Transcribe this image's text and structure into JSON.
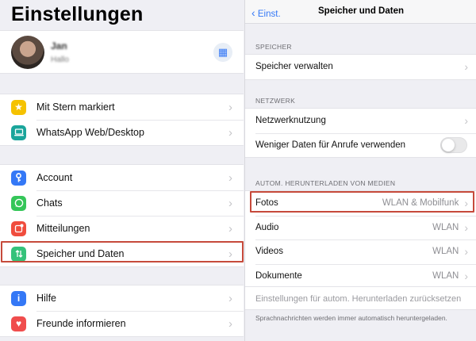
{
  "left": {
    "title": "Einstellungen",
    "profile": {
      "name": "Jan",
      "status": "Hallo",
      "qr_icon": "qr-code-icon"
    },
    "group1": [
      {
        "label": "Mit Stern markiert",
        "icon": "star-icon",
        "color": "#f5c200"
      },
      {
        "label": "WhatsApp Web/Desktop",
        "icon": "laptop-icon",
        "color": "#1aa59b"
      }
    ],
    "group2": [
      {
        "label": "Account",
        "icon": "key-icon",
        "color": "#3478f6"
      },
      {
        "label": "Chats",
        "icon": "whatsapp-icon",
        "color": "#35c659"
      },
      {
        "label": "Mitteilungen",
        "icon": "notification-icon",
        "color": "#f04d3e"
      },
      {
        "label": "Speicher und Daten",
        "icon": "data-arrows-icon",
        "color": "#35c27a"
      }
    ],
    "group3": [
      {
        "label": "Hilfe",
        "icon": "info-icon",
        "color": "#3478f6"
      },
      {
        "label": "Freunde informieren",
        "icon": "heart-icon",
        "color": "#f04d4d"
      }
    ]
  },
  "right": {
    "back_label": "Einst.",
    "title": "Speicher und Daten",
    "sections": {
      "storage_header": "SPEICHER",
      "network_header": "NETZWERK",
      "media_header": "AUTOM. HERUNTERLADEN VON MEDIEN"
    },
    "storage": {
      "manage_label": "Speicher verwalten"
    },
    "network": {
      "usage_label": "Netzwerknutzung",
      "less_data_label": "Weniger Daten für Anrufe verwenden",
      "less_data_on": false
    },
    "media": [
      {
        "label": "Fotos",
        "value": "WLAN & Mobilfunk"
      },
      {
        "label": "Audio",
        "value": "WLAN"
      },
      {
        "label": "Videos",
        "value": "WLAN"
      },
      {
        "label": "Dokumente",
        "value": "WLAN"
      }
    ],
    "reset_label": "Einstellungen für autom. Herunterladen zurücksetzen",
    "footer": "Sprachnachrichten werden immer automatisch heruntergeladen.",
    "highlight_color": "#c64a3b"
  }
}
